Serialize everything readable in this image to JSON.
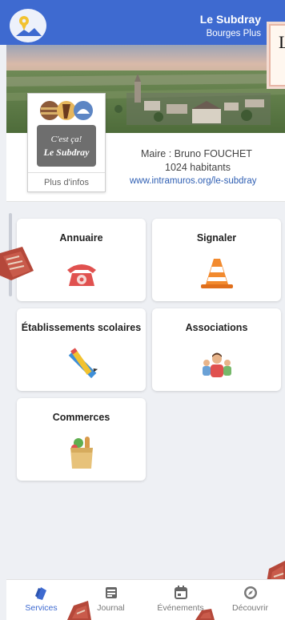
{
  "header": {
    "town": "Le Subdray",
    "subtitle": "Bourges Plus"
  },
  "overlay": {
    "letter": "L"
  },
  "crest": {
    "text_line1": "C'est ça!",
    "text_line2": "Le Subdray",
    "more_info": "Plus d'infos"
  },
  "commune": {
    "mayor": "Maire : Bruno FOUCHET",
    "population": "1024 habitants",
    "website": "www.intramuros.org/le-subdray"
  },
  "tiles": [
    {
      "label": "Annuaire",
      "icon": "phone-icon"
    },
    {
      "label": "Signaler",
      "icon": "traffic-cone-icon"
    },
    {
      "label": "Établissements scolaires",
      "icon": "ruler-pencil-icon"
    },
    {
      "label": "Associations",
      "icon": "people-icon"
    },
    {
      "label": "Commerces",
      "icon": "grocery-bag-icon"
    }
  ],
  "nav": [
    {
      "label": "Services",
      "icon": "services-icon",
      "active": true
    },
    {
      "label": "Journal",
      "icon": "newspaper-icon",
      "active": false
    },
    {
      "label": "Événements",
      "icon": "calendar-icon",
      "active": false
    },
    {
      "label": "Découvrir",
      "icon": "compass-icon",
      "active": false
    }
  ],
  "colors": {
    "primary": "#3e6ad0",
    "link": "#2f5fb3",
    "phone": "#e0514f",
    "cone": "#f28a2e"
  }
}
